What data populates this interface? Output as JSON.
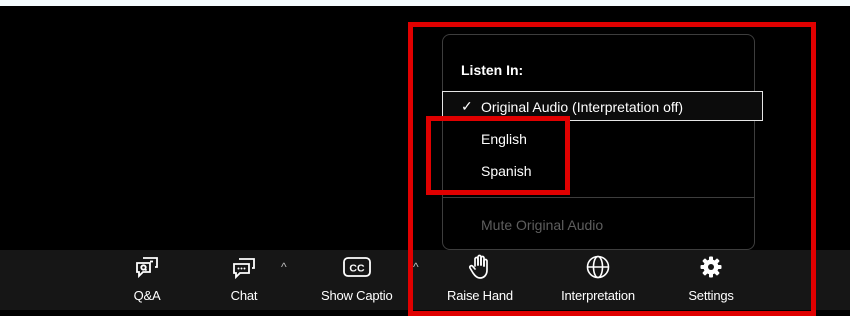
{
  "colors": {
    "annotation": "#e00000",
    "toolbar_bg": "#161616",
    "menu_border": "#3d3d3d",
    "disabled_text": "#5e5e5e"
  },
  "menu": {
    "title": "Listen In:",
    "items": [
      {
        "label": "Original Audio (Interpretation off)",
        "checked": true,
        "check_mark": "✓"
      },
      {
        "label": "English",
        "checked": false
      },
      {
        "label": "Spanish",
        "checked": false
      }
    ],
    "mute_label": "Mute Original Audio"
  },
  "toolbar": {
    "buttons": [
      {
        "label": "Q&A",
        "icon": "qa-icon"
      },
      {
        "label": "Chat",
        "icon": "chat-icon"
      },
      {
        "label": "Show Captions",
        "icon": "cc-icon"
      },
      {
        "label": "Raise Hand",
        "icon": "hand-icon"
      },
      {
        "label": "Interpretation",
        "icon": "globe-icon"
      },
      {
        "label": "Settings",
        "icon": "gear-icon"
      }
    ],
    "caret": "^",
    "cc_text": "CC"
  }
}
